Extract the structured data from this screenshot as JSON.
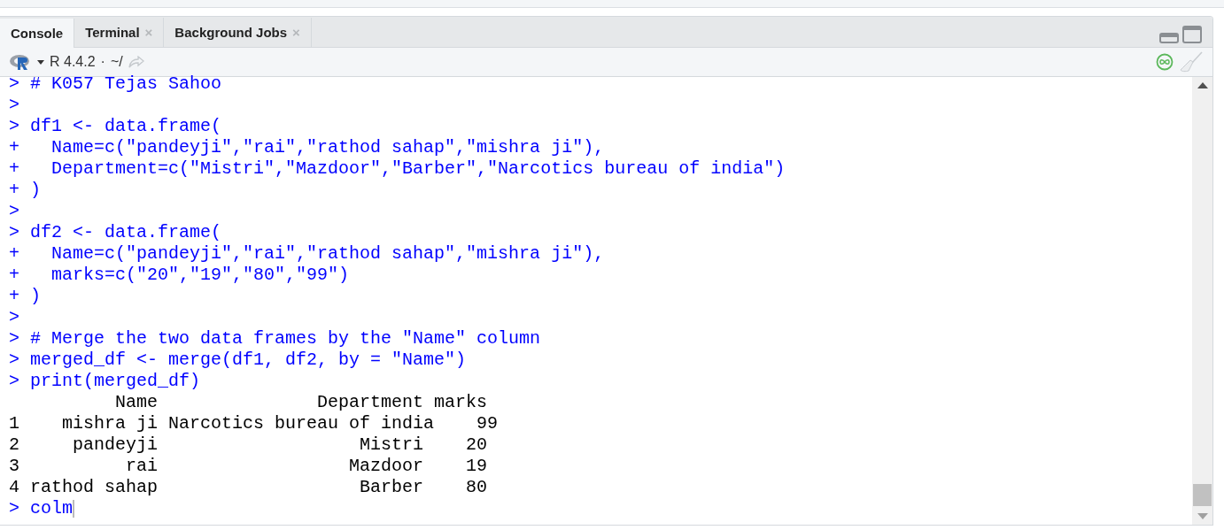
{
  "tabs": [
    {
      "label": "Console",
      "selected": true
    },
    {
      "label": "Terminal",
      "selected": false,
      "close": "×"
    },
    {
      "label": "Background Jobs",
      "selected": false,
      "close": "×"
    }
  ],
  "toolbar": {
    "version": "R 4.4.2",
    "separator": "·",
    "path": "~/"
  },
  "console": {
    "lines": [
      {
        "kind": "input",
        "prompt": ">",
        "code": "# K057 Tejas Sahoo"
      },
      {
        "kind": "input",
        "prompt": ">"
      },
      {
        "kind": "input",
        "prompt": ">",
        "code": "df1 <- data.frame("
      },
      {
        "kind": "input",
        "prompt": "+",
        "code": "  Name=c(\"pandeyji\",\"rai\",\"rathod sahap\",\"mishra ji\"),"
      },
      {
        "kind": "input",
        "prompt": "+",
        "code": "  Department=c(\"Mistri\",\"Mazdoor\",\"Barber\",\"Narcotics bureau of india\")"
      },
      {
        "kind": "input",
        "prompt": "+",
        "code": ")"
      },
      {
        "kind": "input",
        "prompt": ">"
      },
      {
        "kind": "input",
        "prompt": ">",
        "code": "df2 <- data.frame("
      },
      {
        "kind": "input",
        "prompt": "+",
        "code": "  Name=c(\"pandeyji\",\"rai\",\"rathod sahap\",\"mishra ji\"),"
      },
      {
        "kind": "input",
        "prompt": "+",
        "code": "  marks=c(\"20\",\"19\",\"80\",\"99\")"
      },
      {
        "kind": "input",
        "prompt": "+",
        "code": ")"
      },
      {
        "kind": "input",
        "prompt": ">"
      },
      {
        "kind": "input",
        "prompt": ">",
        "code": "# Merge the two data frames by the \"Name\" column"
      },
      {
        "kind": "input",
        "prompt": ">",
        "code": "merged_df <- merge(df1, df2, by = \"Name\")"
      },
      {
        "kind": "input",
        "prompt": ">",
        "code": "print(merged_df)"
      },
      {
        "kind": "output",
        "text": "          Name               Department marks"
      },
      {
        "kind": "output",
        "text": "1    mishra ji Narcotics bureau of india    99"
      },
      {
        "kind": "output",
        "text": "2     pandeyji                   Mistri    20"
      },
      {
        "kind": "output",
        "text": "3          rai                  Mazdoor    19"
      },
      {
        "kind": "output",
        "text": "4 rathod sahap                   Barber    80"
      },
      {
        "kind": "input",
        "prompt": ">",
        "code": "colm",
        "cursor": true
      }
    ]
  }
}
